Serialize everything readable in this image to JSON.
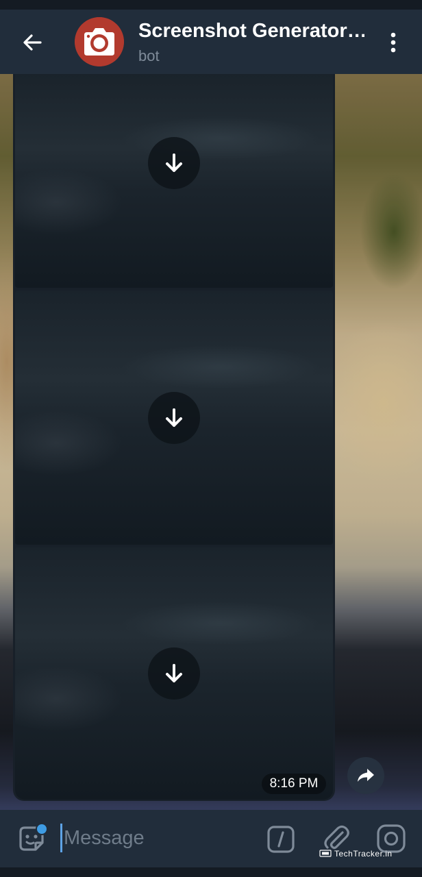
{
  "header": {
    "title": "Screenshot Generator…",
    "subtitle": "bot",
    "back_icon": "arrow-left-icon",
    "menu_icon": "more-vertical-icon",
    "avatar_icon": "camera-icon",
    "avatar_color": "#b23a2e"
  },
  "message": {
    "time": "8:16 PM",
    "media_count": 3,
    "download_icon": "download-arrow-icon",
    "share_icon": "share-forward-icon"
  },
  "composer": {
    "placeholder": "Message",
    "value": "",
    "emoji_icon": "sticker-emoji-icon",
    "command_icon": "slash-command-icon",
    "attach_icon": "paperclip-icon",
    "camera_icon": "instagram-camera-icon",
    "accent": "#3e9ce4"
  },
  "watermark": {
    "text": "TechTracker.in"
  }
}
